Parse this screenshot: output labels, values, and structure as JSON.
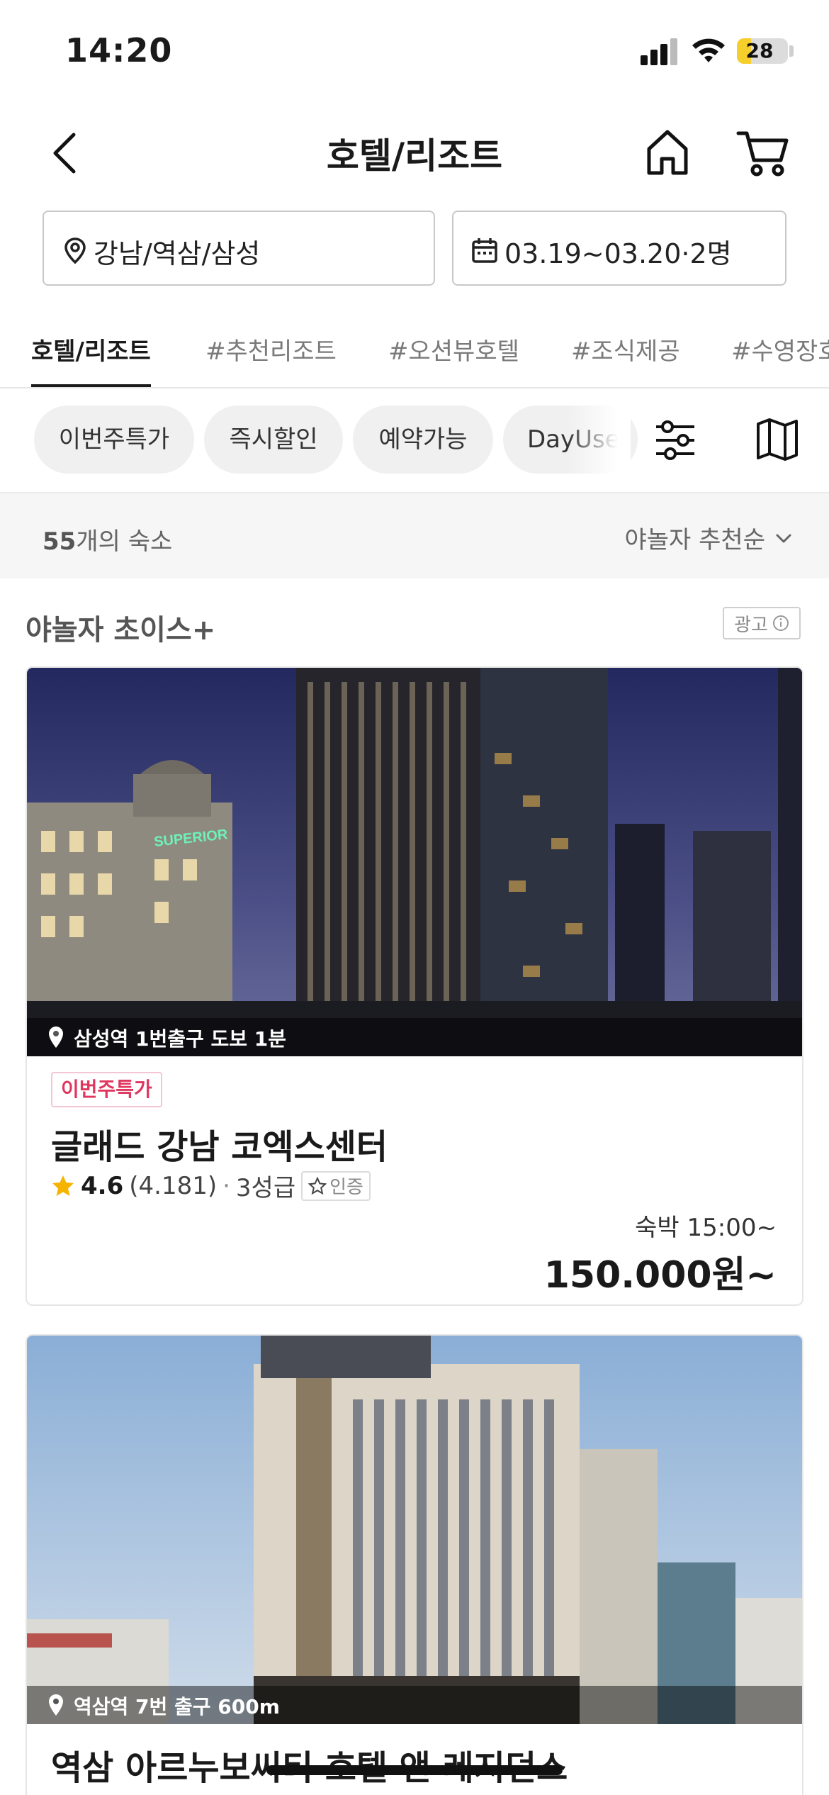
{
  "status_bar": {
    "time": "14:20",
    "battery": "28",
    "battery_level": 0.28
  },
  "header": {
    "title": "호텔/리조트"
  },
  "search": {
    "location": "강남/역삼/삼성",
    "dates_guests": "03.19~03.20·2명"
  },
  "category_tabs": [
    "호텔/리조트",
    "#추천리조트",
    "#오션뷰호텔",
    "#조식제공",
    "#수영장호텔"
  ],
  "filter_chips": [
    "이번주특가",
    "즉시할인",
    "예약가능",
    "DayUse"
  ],
  "listing": {
    "count": "55",
    "count_suffix": "개의 숙소",
    "sort_label": "야놀자 추천순"
  },
  "section": {
    "title": "야놀자 초이스+",
    "ad_label": "광고"
  },
  "hotels": [
    {
      "location_caption": "삼성역 1번출구 도보 1분",
      "badge": "이번주특가",
      "name": "글래드 강남 코엑스센터",
      "rating": "4.6",
      "reviews": "(4.181)",
      "grade": "3성급",
      "cert": "인증",
      "checkin": "숙박 15:00~",
      "price": "150.000원~",
      "sign_text": "SUPERIOR"
    },
    {
      "location_caption": "역삼역 7번 출구 600m",
      "name": "역삼 아르누보씨티 호텔 앤 레지던스"
    }
  ],
  "colors": {
    "badge_red": "#e0375f",
    "star": "#f5b400",
    "chip_bg": "#f0f0f0",
    "battery": "#f6cf2c"
  }
}
